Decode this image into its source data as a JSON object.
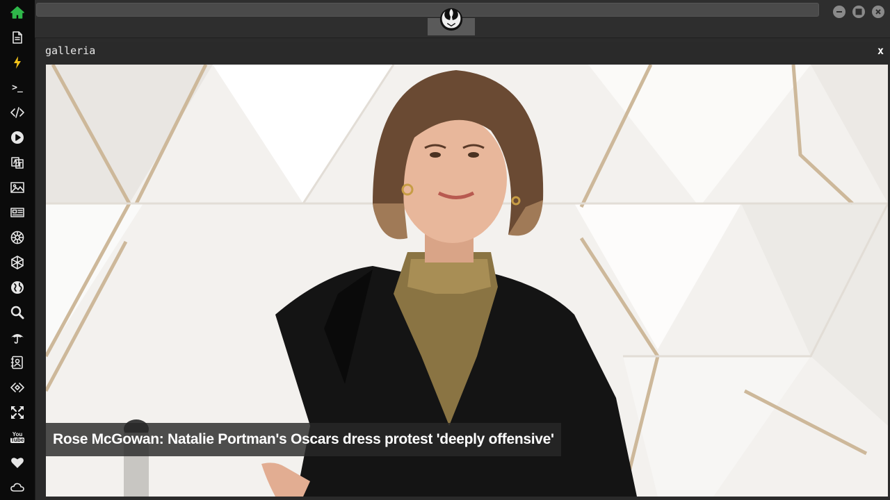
{
  "sidebar": {
    "items": [
      {
        "name": "home-icon"
      },
      {
        "name": "document-icon"
      },
      {
        "name": "bolt-icon"
      },
      {
        "name": "terminal-icon",
        "label": ">_"
      },
      {
        "name": "code-icon"
      },
      {
        "name": "play-icon"
      },
      {
        "name": "translate-icon"
      },
      {
        "name": "image-icon"
      },
      {
        "name": "news-icon"
      },
      {
        "name": "empire-icon"
      },
      {
        "name": "hexagon-icon"
      },
      {
        "name": "globe-icon"
      },
      {
        "name": "search-icon"
      },
      {
        "name": "umbrella-icon"
      },
      {
        "name": "contacts-icon"
      },
      {
        "name": "diamond-code-icon"
      },
      {
        "name": "expand-icon"
      },
      {
        "name": "youtube-icon",
        "label_top": "You",
        "label_bottom": "Tube"
      },
      {
        "name": "heart-icon"
      },
      {
        "name": "cloud-icon"
      }
    ],
    "active_color": "#2fb84a",
    "bolt_color": "#f2c21b"
  },
  "topbar": {
    "center_logo": "rebel-alliance-icon"
  },
  "gallery": {
    "title": "galleria",
    "close_label": "x",
    "caption": "Rose McGowan: Natalie Portman's Oscars dress protest 'deeply offensive'"
  }
}
